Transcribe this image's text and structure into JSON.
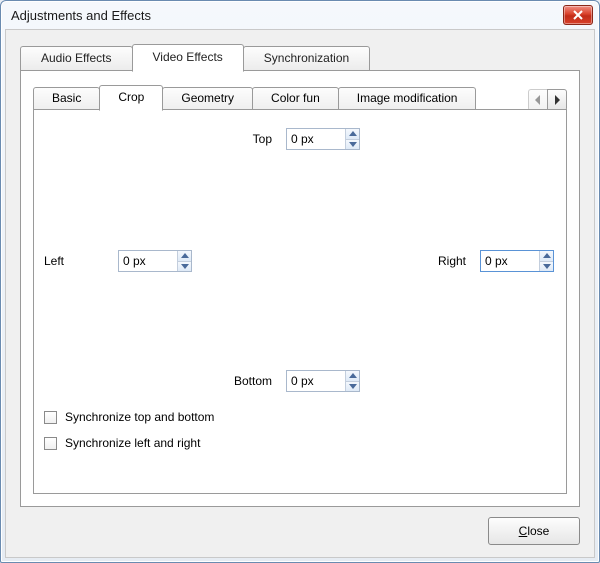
{
  "window": {
    "title": "Adjustments and Effects"
  },
  "outer_tabs": {
    "audio": "Audio Effects",
    "video": "Video Effects",
    "sync": "Synchronization",
    "active": "video"
  },
  "inner_tabs": {
    "basic": "Basic",
    "crop": "Crop",
    "geometry": "Geometry",
    "color_fun": "Color fun",
    "image_mod": "Image modification",
    "active": "crop"
  },
  "crop": {
    "top_label": "Top",
    "top_value": "0 px",
    "left_label": "Left",
    "left_value": "0 px",
    "right_label": "Right",
    "right_value": "0 px",
    "bottom_label": "Bottom",
    "bottom_value": "0 px",
    "sync_tb_label": "Synchronize top and bottom",
    "sync_tb_checked": false,
    "sync_lr_label": "Synchronize left and right",
    "sync_lr_checked": false
  },
  "footer": {
    "close_full": "Close",
    "close_prefix": "",
    "close_accel": "C",
    "close_suffix": "lose"
  }
}
